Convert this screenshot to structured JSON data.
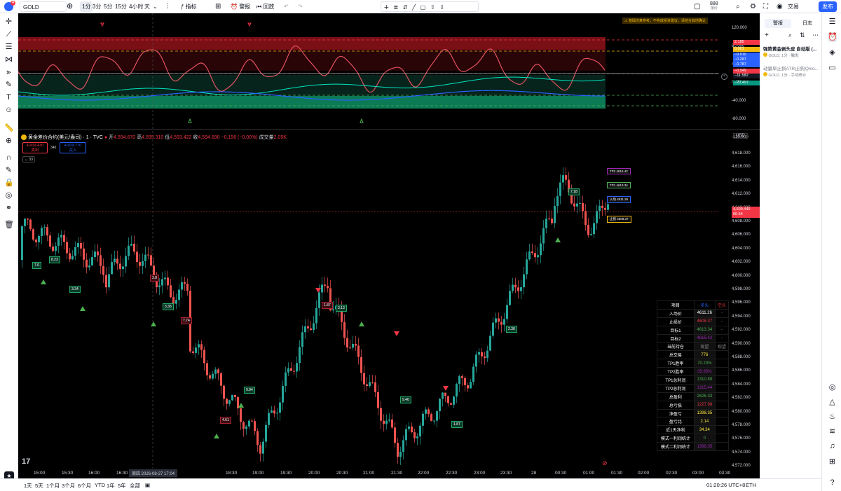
{
  "topbar": {
    "notif_badge": "4",
    "symbol": "GOLD",
    "intervals": [
      "1分",
      "3分",
      "5分",
      "15分",
      "4小时",
      "天"
    ],
    "indicators_label": "指标",
    "alerts_label": "警报",
    "replay_label": "回放",
    "prices_mini": "888",
    "prices_mini_sub": "报价",
    "trade_label": "交易",
    "publish_label": "发布"
  },
  "legend": {
    "title": "黄金差价合约(美元/盎司) · 1 · TVC",
    "open_l": "开",
    "open": "4,594.670",
    "high_l": "高",
    "high": "4,595.310",
    "low_l": "低",
    "low": "4,593.422",
    "close_l": "收",
    "close": "4,594.690",
    "change": "−0.156 (−0.00%)",
    "vol_l": "成交量",
    "vol": "2.05K",
    "sell_price": "4,609.430",
    "sell_label": "卖出",
    "spread": "340",
    "buy_price": "4,609.770",
    "buy_label": "买入",
    "collapse": "33"
  },
  "osc": {
    "warning": "⚠ 基础仿真参考，不构成投资建议，请结合其他确认",
    "levels": [
      "120.000",
      "80.000",
      "40.000",
      "0.000",
      "-40.000",
      "-80.000",
      "-120.000"
    ],
    "labels": [
      {
        "text": "2.185",
        "c": "#f23645"
      },
      {
        "text": "0.001",
        "c": "#f0b90b"
      },
      {
        "text": "−0.010",
        "c": "#2962ff"
      },
      {
        "text": "−0.287",
        "c": "#2962ff"
      },
      {
        "text": "−0.787",
        "c": "#2962ff"
      },
      {
        "text": "−0.949",
        "c": "#f23645"
      },
      {
        "text": "−11.582",
        "c": "#131722"
      },
      {
        "text": "−20.497",
        "c": "#089981"
      }
    ]
  },
  "price_axis": {
    "currency": "USD",
    "levels": [
      "4,618.000",
      "4,616.000",
      "4,614.000",
      "4,612.000",
      "4,610.000",
      "4,608.000",
      "4,606.000",
      "4,604.000",
      "4,602.000",
      "4,600.000",
      "4,598.000",
      "4,596.000",
      "4,594.000",
      "4,592.000",
      "4,590.000",
      "4,588.000",
      "4,586.000",
      "4,584.000",
      "4,582.000",
      "4,580.000",
      "4,578.000",
      "4,576.000",
      "4,574.000",
      "4,572.000"
    ],
    "current": "4,609.440",
    "countdown": "00:34"
  },
  "time_axis": {
    "labels": [
      "15:00",
      "15:30",
      "16:00",
      "16:30",
      "18:00",
      "18:30",
      "19:00",
      "19:30",
      "20:00",
      "20:30",
      "21:00",
      "21:30",
      "22:00",
      "22:30",
      "23:00",
      "23:30",
      "28",
      "00:30",
      "01:00",
      "01:30",
      "02:00",
      "02:30",
      "03:00",
      "03:30"
    ],
    "cursor": "周四 2026-08-27  17:04"
  },
  "targets": {
    "tp2": "TP2 4615.42",
    "tp1": "TP1 4613.34",
    "entry": "入场 4611.26",
    "stop": "止损 4608.37",
    "mid_tag": "7.18"
  },
  "signals": [
    "7.6",
    "8.23",
    "3.34",
    "3.36",
    "7.74",
    "3.8",
    "9.94",
    "4.61",
    "1.87",
    "3.13",
    "9.46",
    "1.87",
    "2.38"
  ],
  "stats": {
    "header": [
      "项目",
      "多头",
      "空头"
    ],
    "rows": [
      [
        "入场价",
        "4611.26",
        "-"
      ],
      [
        "止损价",
        "4608.37",
        "-"
      ],
      [
        "目标1",
        "4613.34",
        "-"
      ],
      [
        "目标2",
        "4615.42",
        "-"
      ],
      [
        "当前持仓",
        "观望",
        "观望"
      ],
      [
        "总交易",
        "776",
        ""
      ],
      [
        "TP1胜率",
        "70.23%",
        ""
      ],
      [
        "TP2胜率",
        "35.95%",
        ""
      ],
      [
        "TP1总利润",
        "1310.89",
        ""
      ],
      [
        "TP2总利润",
        "1315.44",
        ""
      ],
      [
        "总盈利",
        "2626.33",
        ""
      ],
      [
        "总亏损",
        "1227.98",
        ""
      ],
      [
        "净盈亏",
        "1398.35",
        ""
      ],
      [
        "盈亏比",
        "2.14",
        ""
      ],
      [
        "近1天净利",
        "34.34",
        ""
      ],
      [
        "模式一利润统计",
        "0",
        ""
      ],
      [
        "模式二利润统计",
        "1398.35",
        ""
      ]
    ],
    "value_colors": [
      "#fff",
      "#f23645",
      "#4caf50",
      "#9c27b0",
      "#888",
      "#ffeb3b",
      "#4caf50",
      "#9c27b0",
      "#4caf50",
      "#9c27b0",
      "#4caf50",
      "#f23645",
      "#ffeb3b",
      "#ffeb3b",
      "#ffeb3b",
      "#4caf50",
      "#9c27b0"
    ]
  },
  "bottombar": {
    "ranges": [
      "1天",
      "5天",
      "1个月",
      "3个月",
      "6个月",
      "YTD",
      "1年",
      "5年",
      "全部"
    ],
    "clock": "01:20:26 UTC+8",
    "session": "ETH"
  },
  "rpanel": {
    "tabs": [
      "警报",
      "日志"
    ],
    "alert1_title": "强势黄金剥头皮 自动版 (...",
    "alert1_sub": "GOLD, 1分 · 触发",
    "alert2_title": "动量早止损ATR止损[Qino...",
    "alert2_sub": "GOLD, 1分 · 手动停止"
  },
  "colors": {
    "up": "#26a69a",
    "down": "#ef5350",
    "bg": "#000000",
    "accent": "#2962ff"
  }
}
